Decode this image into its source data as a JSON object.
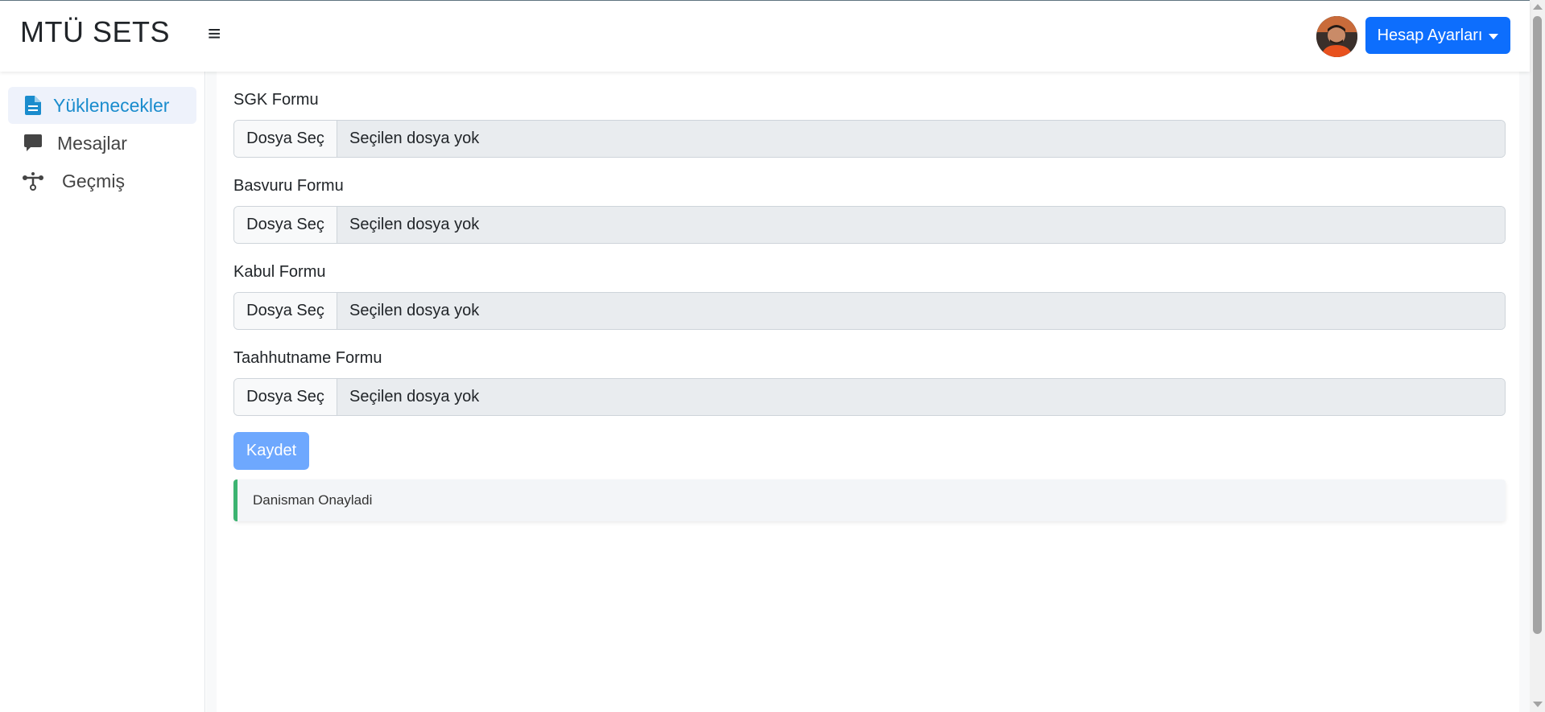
{
  "header": {
    "brand": "MTÜ SETS",
    "menu_icon": "hamburger-icon",
    "avatar_icon": "user-avatar",
    "account_label": "Hesap Ayarları"
  },
  "sidebar": {
    "items": [
      {
        "label": "Yüklenecekler",
        "icon": "file-icon",
        "active": true
      },
      {
        "label": "Mesajlar",
        "icon": "message-icon",
        "active": false
      },
      {
        "label": "Geçmiş",
        "icon": "timeline-icon",
        "active": false
      }
    ]
  },
  "forms": [
    {
      "label": "SGK Formu",
      "button": "Dosya Seç",
      "value": "Seçilen dosya yok"
    },
    {
      "label": "Basvuru Formu",
      "button": "Dosya Seç",
      "value": "Seçilen dosya yok"
    },
    {
      "label": "Kabul Formu",
      "button": "Dosya Seç",
      "value": "Seçilen dosya yok"
    },
    {
      "label": "Taahhutname Formu",
      "button": "Dosya Seç",
      "value": "Seçilen dosya yok"
    }
  ],
  "save_label": "Kaydet",
  "status_message": "Danisman Onayladi",
  "colors": {
    "primary": "#0d6efd",
    "primary_light": "#6ea8fe",
    "active_link": "#1a8ccd",
    "success_border": "#3cb371"
  }
}
